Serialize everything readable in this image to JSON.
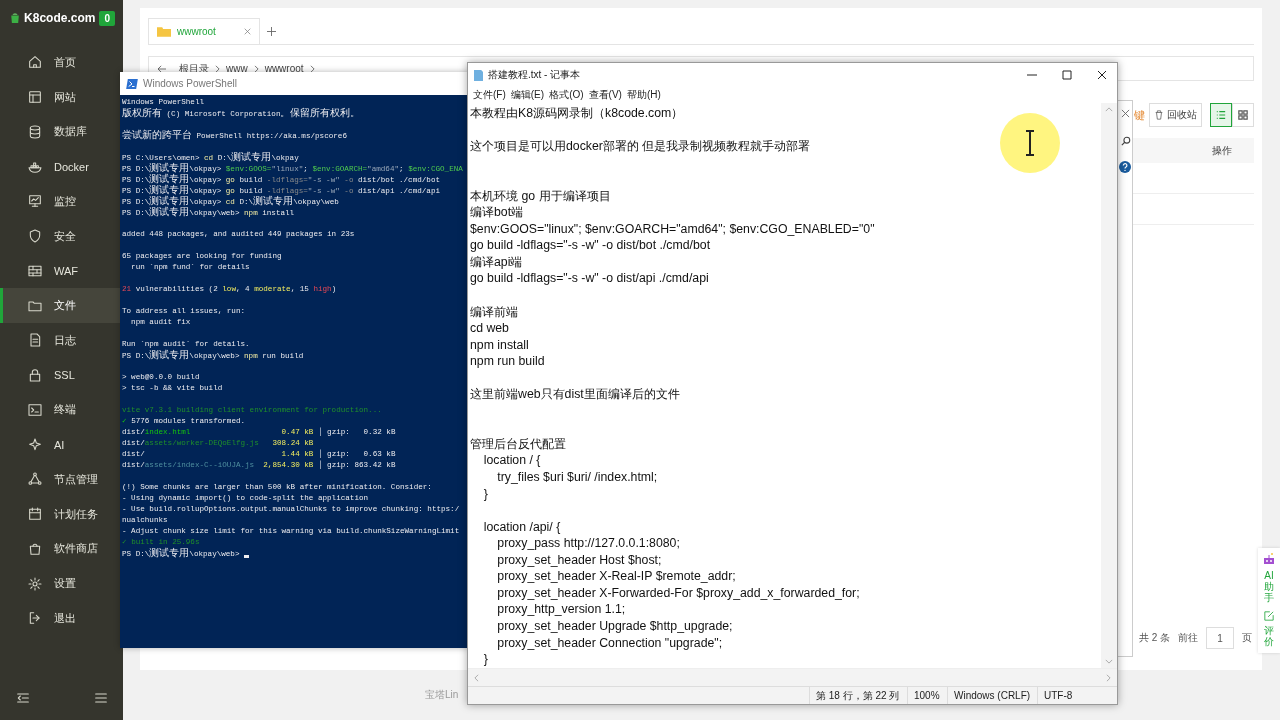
{
  "sidebar": {
    "site": "K8code.com",
    "badge": "0",
    "items": [
      {
        "label": "首页",
        "selected": false
      },
      {
        "label": "网站",
        "selected": false
      },
      {
        "label": "数据库",
        "selected": false
      },
      {
        "label": "Docker",
        "selected": false
      },
      {
        "label": "监控",
        "selected": false
      },
      {
        "label": "安全",
        "selected": false
      },
      {
        "label": "WAF",
        "selected": false
      },
      {
        "label": "文件",
        "selected": true
      },
      {
        "label": "日志",
        "selected": false
      },
      {
        "label": "SSL",
        "selected": false
      },
      {
        "label": "终端",
        "selected": false
      },
      {
        "label": "AI",
        "selected": false
      },
      {
        "label": "节点管理",
        "selected": false
      },
      {
        "label": "计划任务",
        "selected": false
      },
      {
        "label": "软件商店",
        "selected": false
      },
      {
        "label": "设置",
        "selected": false
      },
      {
        "label": "退出",
        "selected": false
      }
    ]
  },
  "file_manager": {
    "tab": "wwwroot",
    "breadcrumb": [
      "根目录",
      "www",
      "wwwroot"
    ],
    "hint": "键",
    "recycle_button": "回收站",
    "views": [
      {
        "kind": "list",
        "selected": true
      },
      {
        "kind": "grid",
        "selected": false
      }
    ],
    "column_header": "操作",
    "pagination": {
      "total": "共 2 条",
      "goto": "前往",
      "page": "1",
      "unit": "页"
    },
    "footer": "宝塔Lin"
  },
  "assistant": {
    "label": "AI助手",
    "review": "评价"
  },
  "powershell": {
    "title": "Windows PowerShell",
    "lines": [
      {
        "kind": "text",
        "segments": [
          {
            "text": "Windows PowerShell",
            "kind": "plain"
          }
        ]
      },
      {
        "kind": "text",
        "segments": [
          {
            "text": "版权所有 (C) Microsoft Corporation。保留所有权利。",
            "kind": "plain"
          }
        ]
      },
      {
        "kind": "blank"
      },
      {
        "kind": "text",
        "segments": [
          {
            "text": "尝试新的跨平台 PowerShell https://aka.ms/pscore6",
            "kind": "plain"
          }
        ]
      },
      {
        "kind": "blank"
      },
      {
        "kind": "text",
        "segments": [
          {
            "text": "PS C:\\Users\\omen> ",
            "kind": "plain"
          },
          {
            "text": "cd",
            "kind": "command"
          },
          {
            "text": " D:\\测试专用\\okpay",
            "kind": "plain"
          }
        ]
      },
      {
        "kind": "text",
        "segments": [
          {
            "text": "PS D:\\测试专用\\okpay> ",
            "kind": "plain"
          },
          {
            "text": "$env:GOOS=",
            "kind": "variable"
          },
          {
            "text": "\"linux\"",
            "kind": "string"
          },
          {
            "text": "; ",
            "kind": "plain"
          },
          {
            "text": "$env:GOARCH=",
            "kind": "variable"
          },
          {
            "text": "\"amd64\"",
            "kind": "string"
          },
          {
            "text": "; ",
            "kind": "plain"
          },
          {
            "text": "$env:CGO_ENA",
            "kind": "variable"
          }
        ]
      },
      {
        "kind": "text",
        "segments": [
          {
            "text": "PS D:\\测试专用\\okpay> ",
            "kind": "plain"
          },
          {
            "text": "go",
            "kind": "command"
          },
          {
            "text": " build ",
            "kind": "plain"
          },
          {
            "text": "-ldflags=",
            "kind": "parameter"
          },
          {
            "text": "\"-s -w\"",
            "kind": "string"
          },
          {
            "text": " -o",
            "kind": "parameter"
          },
          {
            "text": " dist/bot ./cmd/bot",
            "kind": "plain"
          }
        ]
      },
      {
        "kind": "text",
        "segments": [
          {
            "text": "PS D:\\测试专用\\okpay> ",
            "kind": "plain"
          },
          {
            "text": "go",
            "kind": "command"
          },
          {
            "text": " build ",
            "kind": "plain"
          },
          {
            "text": "-ldflags=",
            "kind": "parameter"
          },
          {
            "text": "\"-s -w\"",
            "kind": "string"
          },
          {
            "text": " -o",
            "kind": "parameter"
          },
          {
            "text": " dist/api ./cmd/api",
            "kind": "plain"
          }
        ]
      },
      {
        "kind": "text",
        "segments": [
          {
            "text": "PS D:\\测试专用\\okpay> ",
            "kind": "plain"
          },
          {
            "text": "cd",
            "kind": "command"
          },
          {
            "text": " D:\\测试专用\\okpay\\web",
            "kind": "plain"
          }
        ]
      },
      {
        "kind": "text",
        "segments": [
          {
            "text": "PS D:\\测试专用\\okpay\\web> ",
            "kind": "plain"
          },
          {
            "text": "npm",
            "kind": "command"
          },
          {
            "text": " install",
            "kind": "plain"
          }
        ]
      },
      {
        "kind": "blank"
      },
      {
        "kind": "text",
        "segments": [
          {
            "text": "added 448 packages, and audited 449 packages in 23s",
            "kind": "plain"
          }
        ]
      },
      {
        "kind": "blank"
      },
      {
        "kind": "text",
        "segments": [
          {
            "text": "65 packages are looking for funding",
            "kind": "plain"
          }
        ]
      },
      {
        "kind": "text",
        "segments": [
          {
            "text": "  run `npm fund` for details",
            "kind": "plain"
          }
        ]
      },
      {
        "kind": "blank"
      },
      {
        "kind": "text",
        "segments": [
          {
            "text": "21",
            "kind": "error"
          },
          {
            "text": " vulnerabilities (2 ",
            "kind": "plain"
          },
          {
            "text": "low",
            "kind": "warning"
          },
          {
            "text": ", 4 ",
            "kind": "plain"
          },
          {
            "text": "moderate",
            "kind": "warning"
          },
          {
            "text": ", 15 ",
            "kind": "plain"
          },
          {
            "text": "high",
            "kind": "error"
          },
          {
            "text": ")",
            "kind": "plain"
          }
        ]
      },
      {
        "kind": "blank"
      },
      {
        "kind": "text",
        "segments": [
          {
            "text": "To address all issues, run:",
            "kind": "plain"
          }
        ]
      },
      {
        "kind": "text",
        "segments": [
          {
            "text": "  npm audit fix",
            "kind": "plain"
          }
        ]
      },
      {
        "kind": "blank"
      },
      {
        "kind": "text",
        "segments": [
          {
            "text": "Run `npm audit` for details.",
            "kind": "plain"
          }
        ]
      },
      {
        "kind": "text",
        "segments": [
          {
            "text": "PS D:\\测试专用\\okpay\\web> ",
            "kind": "plain"
          },
          {
            "text": "npm",
            "kind": "command"
          },
          {
            "text": " run build",
            "kind": "plain"
          }
        ]
      },
      {
        "kind": "blank"
      },
      {
        "kind": "text",
        "segments": [
          {
            "text": "> web@0.0.0 build",
            "kind": "plain"
          }
        ]
      },
      {
        "kind": "text",
        "segments": [
          {
            "text": "> tsc -b && vite build",
            "kind": "plain"
          }
        ]
      },
      {
        "kind": "blank"
      },
      {
        "kind": "text",
        "segments": [
          {
            "text": "vite v7.3.1 building client environment for production...",
            "kind": "info"
          }
        ]
      },
      {
        "kind": "text",
        "segments": [
          {
            "text": "✓",
            "kind": "success"
          },
          {
            "text": " 5776 modules transformed.",
            "kind": "plain"
          }
        ]
      },
      {
        "kind": "text",
        "segments": [
          {
            "text": "dist/",
            "kind": "plain"
          },
          {
            "text": "index.html",
            "kind": "success"
          },
          {
            "text": "                    0.47 kB",
            "kind": "warning"
          },
          {
            "text": " │ gzip:   0.32 kB",
            "kind": "plain"
          }
        ]
      },
      {
        "kind": "text",
        "segments": [
          {
            "text": "dist/",
            "kind": "plain"
          },
          {
            "text": "assets/worker-DEQoElfg.js",
            "kind": "info"
          },
          {
            "text": "   308.24 kB",
            "kind": "warning"
          }
        ]
      },
      {
        "kind": "text",
        "segments": [
          {
            "text": "dist/",
            "kind": "plain"
          },
          {
            "text": "                              1.44 kB",
            "kind": "warning"
          },
          {
            "text": " │ gzip:   0.63 kB",
            "kind": "plain"
          }
        ]
      },
      {
        "kind": "text",
        "segments": [
          {
            "text": "dist/",
            "kind": "plain"
          },
          {
            "text": "assets/index-C--iOUJA.js",
            "kind": "asset"
          },
          {
            "text": "  2,854.30 kB",
            "kind": "warning"
          },
          {
            "text": " │ gzip: 863.42 kB",
            "kind": "plain"
          }
        ]
      },
      {
        "kind": "blank"
      },
      {
        "kind": "text",
        "segments": [
          {
            "text": "(!) Some chunks are larger than 500 kB after minification. Consider:",
            "kind": "plain"
          }
        ]
      },
      {
        "kind": "text",
        "segments": [
          {
            "text": "- Using dynamic import() to code-split the application",
            "kind": "plain"
          }
        ]
      },
      {
        "kind": "text",
        "segments": [
          {
            "text": "- Use build.rollupOptions.output.manualChunks to improve chunking: https:/",
            "kind": "plain"
          }
        ]
      },
      {
        "kind": "text",
        "segments": [
          {
            "text": "nualchunks",
            "kind": "plain"
          }
        ]
      },
      {
        "kind": "text",
        "segments": [
          {
            "text": "- Adjust chunk size limit for this warning via build.chunkSizeWarningLimit",
            "kind": "plain"
          }
        ]
      },
      {
        "kind": "text",
        "segments": [
          {
            "text": "✓ built in 25.96s",
            "kind": "info"
          }
        ]
      },
      {
        "kind": "text",
        "cursor": true,
        "segments": [
          {
            "text": "PS D:\\测试专用\\okpay\\web> ",
            "kind": "plain"
          }
        ]
      }
    ]
  },
  "notepad": {
    "title": "搭建教程.txt - 记事本",
    "menu": [
      "文件(F)",
      "编辑(E)",
      "格式(O)",
      "查看(V)",
      "帮助(H)"
    ],
    "lines": [
      {
        "kind": "text",
        "text": "本教程由K8源码网录制（k8code.com）"
      },
      {
        "kind": "blank"
      },
      {
        "kind": "text",
        "text": "这个项目是可以用docker部署的 但是我录制视频教程就手动部署"
      },
      {
        "kind": "blank"
      },
      {
        "kind": "blank"
      },
      {
        "kind": "text",
        "text": "本机环境 go 用于编译项目"
      },
      {
        "kind": "text",
        "text": "编译bot端"
      },
      {
        "kind": "text",
        "text": "$env:GOOS=\"linux\"; $env:GOARCH=\"amd64\"; $env:CGO_ENABLED=\"0\""
      },
      {
        "kind": "text",
        "text": "go build -ldflags=\"-s -w\" -o dist/bot ./cmd/bot"
      },
      {
        "kind": "text",
        "text": "编译api端"
      },
      {
        "kind": "text",
        "text": "go build -ldflags=\"-s -w\" -o dist/api ./cmd/api"
      },
      {
        "kind": "blank"
      },
      {
        "kind": "text",
        "text": "编译前端"
      },
      {
        "kind": "text",
        "text": "cd web"
      },
      {
        "kind": "text",
        "text": "npm install"
      },
      {
        "kind": "text",
        "text": "npm run build"
      },
      {
        "kind": "blank"
      },
      {
        "kind": "text",
        "text": "这里前端web只有dist里面编译后的文件"
      },
      {
        "kind": "blank"
      },
      {
        "kind": "blank"
      },
      {
        "kind": "text",
        "text": "管理后台反代配置"
      },
      {
        "kind": "text",
        "text": "    location / {"
      },
      {
        "kind": "text",
        "text": "        try_files $uri $uri/ /index.html;"
      },
      {
        "kind": "text",
        "text": "    }"
      },
      {
        "kind": "blank"
      },
      {
        "kind": "text",
        "text": "    location /api/ {"
      },
      {
        "kind": "text",
        "text": "        proxy_pass http://127.0.0.1:8080;"
      },
      {
        "kind": "text",
        "text": "        proxy_set_header Host $host;"
      },
      {
        "kind": "text",
        "text": "        proxy_set_header X-Real-IP $remote_addr;"
      },
      {
        "kind": "text",
        "text": "        proxy_set_header X-Forwarded-For $proxy_add_x_forwarded_for;"
      },
      {
        "kind": "text",
        "text": "        proxy_http_version 1.1;"
      },
      {
        "kind": "text",
        "text": "        proxy_set_header Upgrade $http_upgrade;"
      },
      {
        "kind": "text",
        "text": "        proxy_set_header Connection \"upgrade\";"
      },
      {
        "kind": "text",
        "text": "    }"
      }
    ],
    "status": {
      "position": "第 18 行，第 22 列",
      "zoom": "100%",
      "line_ending": "Windows (CRLF)",
      "encoding": "UTF-8"
    }
  }
}
